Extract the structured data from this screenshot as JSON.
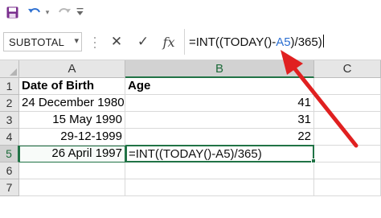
{
  "colors": {
    "accent_green": "#217346",
    "arrow_red": "#e02020",
    "cell_ref_blue": "#2c6fd1",
    "save_icon_purple": "#7a2f8e"
  },
  "toolbar": {
    "save_icon": "save-icon",
    "undo_icon": "undo-icon",
    "redo_icon": "redo-icon",
    "customize_icon": "customize-qat-icon"
  },
  "formula_bar": {
    "name_box": "SUBTOTAL",
    "cancel_glyph": "✕",
    "enter_glyph": "✓",
    "fx_glyph": "fx",
    "formula_prefix": "=INT((TODAY()-",
    "formula_ref": "A5",
    "formula_suffix": ")/365)"
  },
  "grid": {
    "columns": [
      "A",
      "B",
      "C"
    ],
    "rows": [
      "1",
      "2",
      "3",
      "4",
      "5",
      "6",
      "7"
    ],
    "active_cell": "B5",
    "header": {
      "a": "Date of Birth",
      "b": "Age"
    },
    "data": [
      {
        "a": "24 December 1980",
        "b": "41"
      },
      {
        "a": "15 May 1990",
        "b": "31"
      },
      {
        "a": "29-12-1999",
        "b": "22"
      },
      {
        "a": "26 April 1997",
        "b": "=INT((TODAY()-A5)/365)"
      }
    ]
  }
}
